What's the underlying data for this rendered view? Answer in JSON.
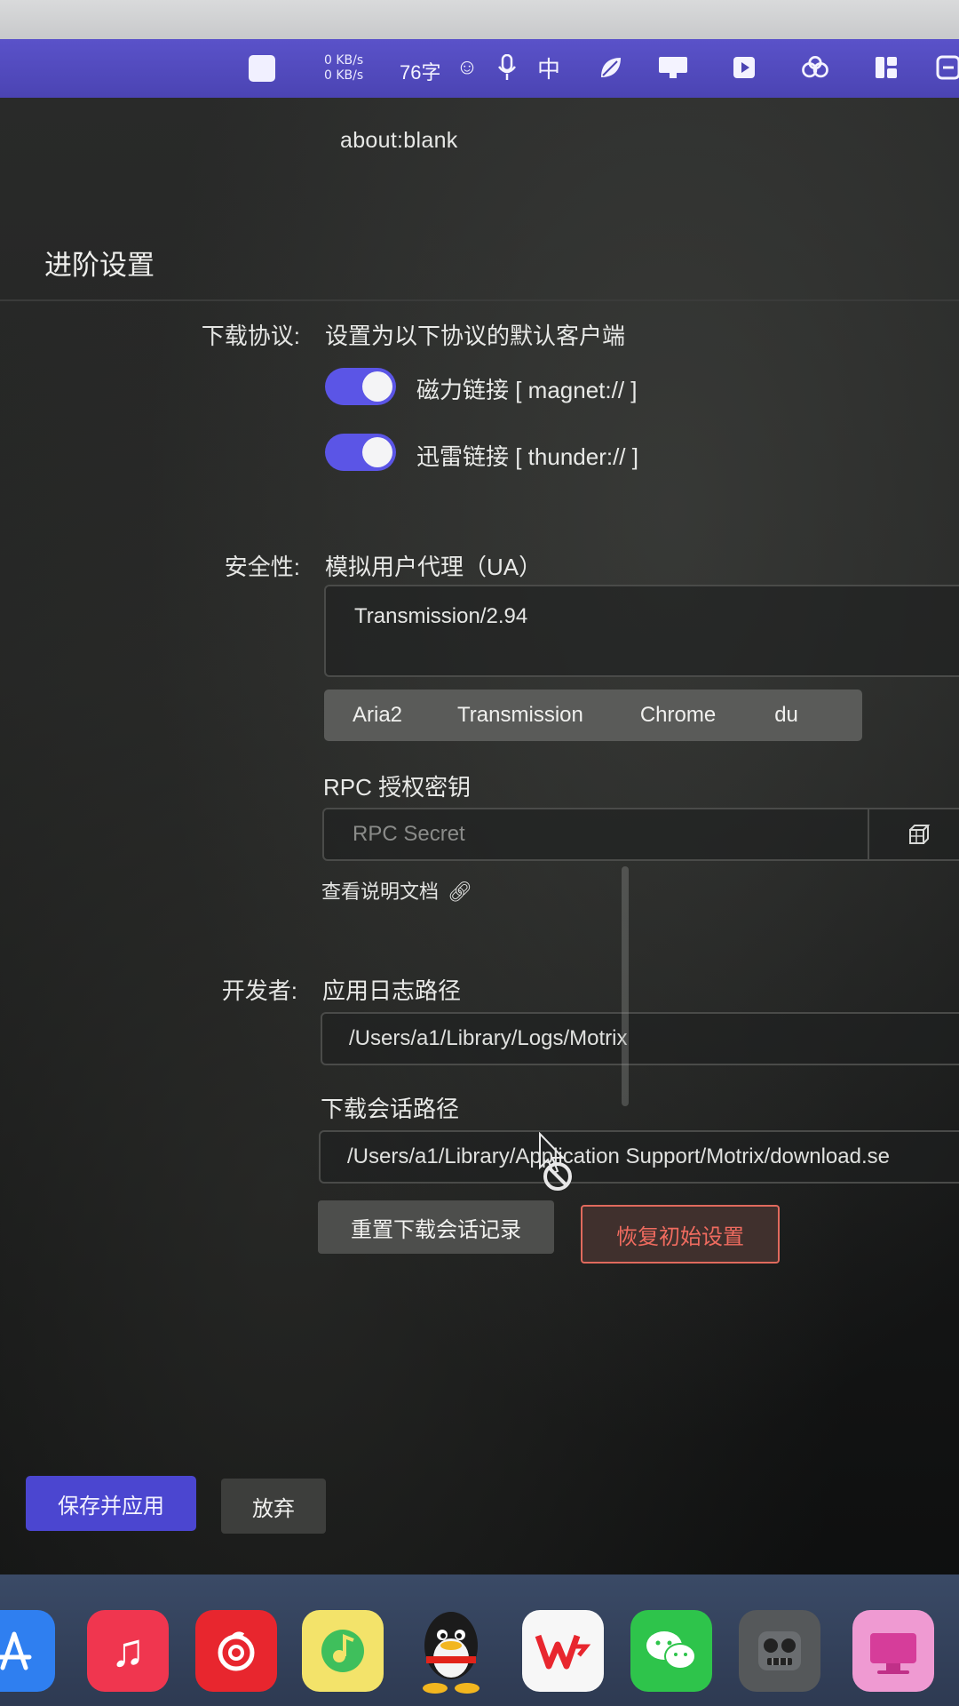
{
  "menubar": {
    "net_up": "0 KB/s",
    "net_down": "0 KB/s",
    "word_count": "76字",
    "input_method": "中",
    "icons": [
      "status-icon",
      "emoji-icon",
      "mic-icon",
      "leaf-icon",
      "display-icon",
      "media-icon",
      "flower-icon",
      "layout-icon",
      "notes-icon"
    ]
  },
  "browser": {
    "url": "about:blank"
  },
  "settings": {
    "title": "进阶设置",
    "protocol": {
      "label": "下载协议:",
      "description": "设置为以下协议的默认客户端",
      "magnet_label": "磁力链接 [ magnet:// ]",
      "magnet_on": true,
      "thunder_label": "迅雷链接 [ thunder:// ]",
      "thunder_on": true
    },
    "security": {
      "label": "安全性:",
      "ua_title": "模拟用户代理（UA）",
      "ua_value": "Transmission/2.94",
      "presets": [
        "Aria2",
        "Transmission",
        "Chrome",
        "du"
      ],
      "rpc_title": "RPC 授权密钥",
      "rpc_placeholder": "RPC Secret",
      "doc_link": "查看说明文档"
    },
    "developer": {
      "label": "开发者:",
      "log_path_title": "应用日志路径",
      "log_path": "/Users/a1/Library/Logs/Motrix",
      "session_path_title": "下载会话路径",
      "session_path": "/Users/a1/Library/Application Support/Motrix/download.se",
      "reset_session_label": "重置下载会话记录",
      "restore_defaults_label": "恢复初始设置"
    },
    "footer": {
      "save_label": "保存并应用",
      "discard_label": "放弃"
    }
  },
  "dock": {
    "apps": [
      "app-store-icon",
      "music-icon",
      "netease-music-icon",
      "qq-music-icon",
      "qq-icon",
      "wps-icon",
      "wechat-icon",
      "robot-app-icon",
      "cleanmymac-icon"
    ]
  },
  "colors": {
    "accent": "#5b55e6",
    "danger": "#ef6b5f",
    "menubar": "#4b44b3"
  }
}
